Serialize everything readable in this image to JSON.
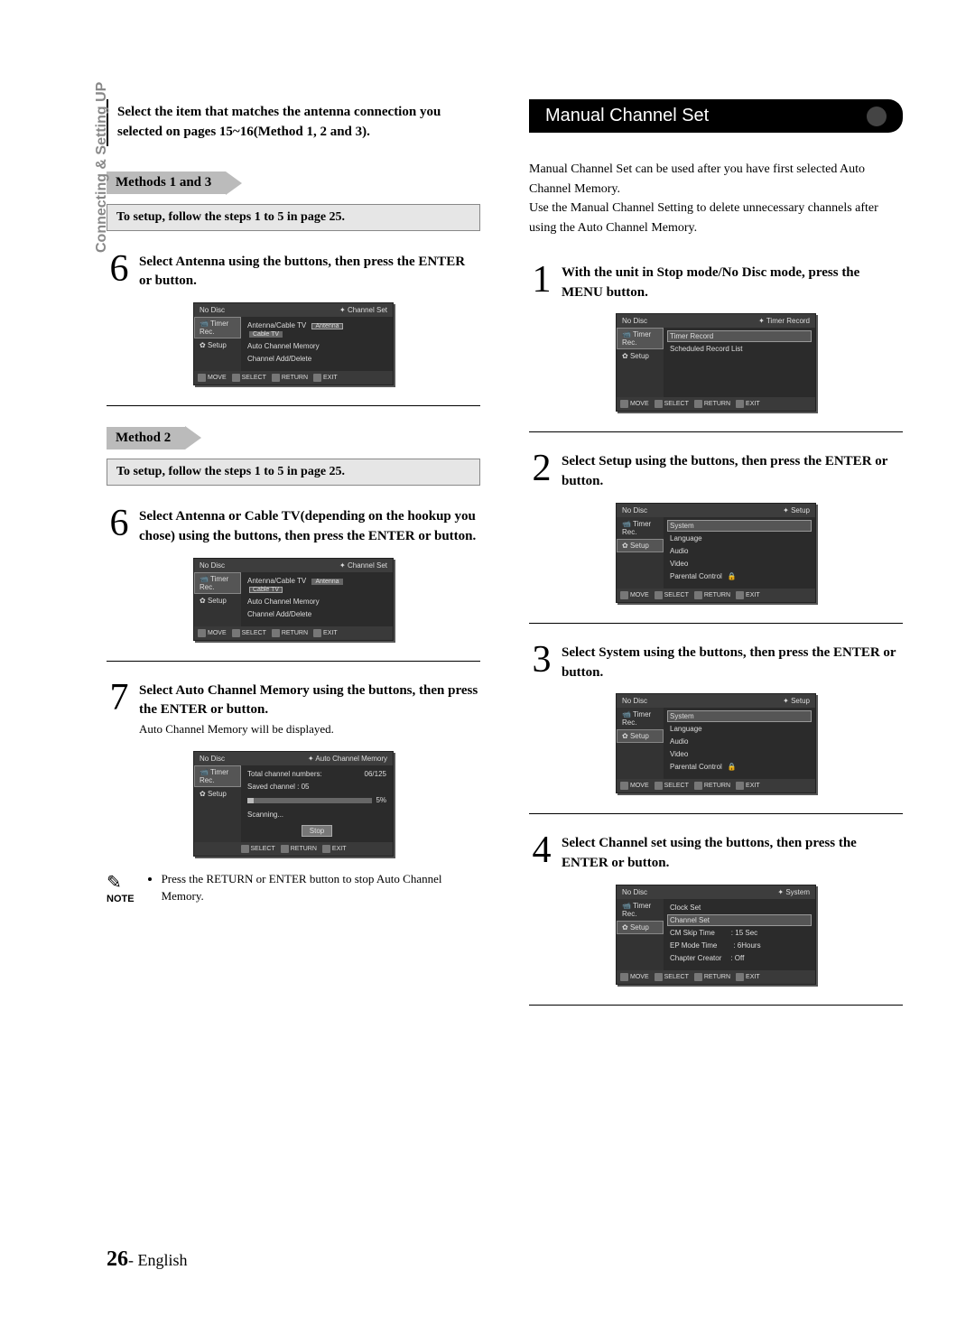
{
  "side_tab": "Connecting & Setting UP",
  "intro": "Select the item that matches the antenna connection you selected on pages 15~16(Method 1, 2 and 3).",
  "methods13": "Methods 1 and 3",
  "method2": "Method 2",
  "sub_setup": "To setup, follow the steps 1 to 5 in page 25.",
  "left": {
    "s6a": "Select Antenna using the         buttons, then press the ENTER or        button.",
    "s6b": "Select Antenna or Cable TV(depending on the hookup you chose) using the            buttons, then press the ENTER or        button.",
    "s7": "Select Auto Channel Memory using the         buttons, then press the ENTER or        button.",
    "s7_desc": "Auto Channel Memory will be displayed.",
    "note_label": "NOTE",
    "note_item": "Press the RETURN or ENTER button to stop Auto Channel Memory."
  },
  "pill_title": "Manual Channel Set",
  "right_para": "Manual Channel Set can be used after you have first selected Auto Channel Memory.\nUse the Manual Channel Setting to delete unnecessary channels after using the Auto Channel Memory.",
  "right": {
    "s1": "With the unit in Stop mode/No Disc mode, press the MENU button.",
    "s2": "Select Setup using the           buttons, then press the ENTER or        button.",
    "s3": "Select System using the          buttons, then press the ENTER or        button.",
    "s4": "Select Channel set using the           buttons, then press the ENTER or        button."
  },
  "osd_common": {
    "nodisc": "No Disc",
    "timer": "Timer Rec.",
    "setup": "Setup",
    "move": "MOVE",
    "select": "SELECT",
    "return": "RETURN",
    "exit": "EXIT"
  },
  "osd_chset": {
    "crumb": "Channel Set",
    "r1": "Antenna/Cable TV",
    "r1a": "Antenna",
    "r1b": "Cable TV",
    "r2": "Auto Channel Memory",
    "r3": "Channel Add/Delete"
  },
  "osd_auto": {
    "crumb": "Auto Channel Memory",
    "line1": "Total channel numbers:",
    "line1v": "06/125",
    "line2": "Saved channel   :   05",
    "pct": "5%",
    "scanning": "Scanning...",
    "stop": "Stop"
  },
  "osd_timer": {
    "crumb": "Timer Record",
    "r1": "Timer Record",
    "r2": "Scheduled Record List"
  },
  "osd_setup": {
    "crumb": "Setup",
    "r1": "System",
    "r2": "Language",
    "r3": "Audio",
    "r4": "Video",
    "r5": "Parental Control"
  },
  "osd_system": {
    "crumb": "System",
    "r1": "Clock Set",
    "r2": "Channel Set",
    "r3": "CM Skip Time",
    "r3v": ": 15 Sec",
    "r4": "EP Mode Time",
    "r4v": ": 6Hours",
    "r5": "Chapter Creator",
    "r5v": ": Off"
  },
  "footer": {
    "page": "26",
    "dash": "-",
    "lang": "English"
  }
}
